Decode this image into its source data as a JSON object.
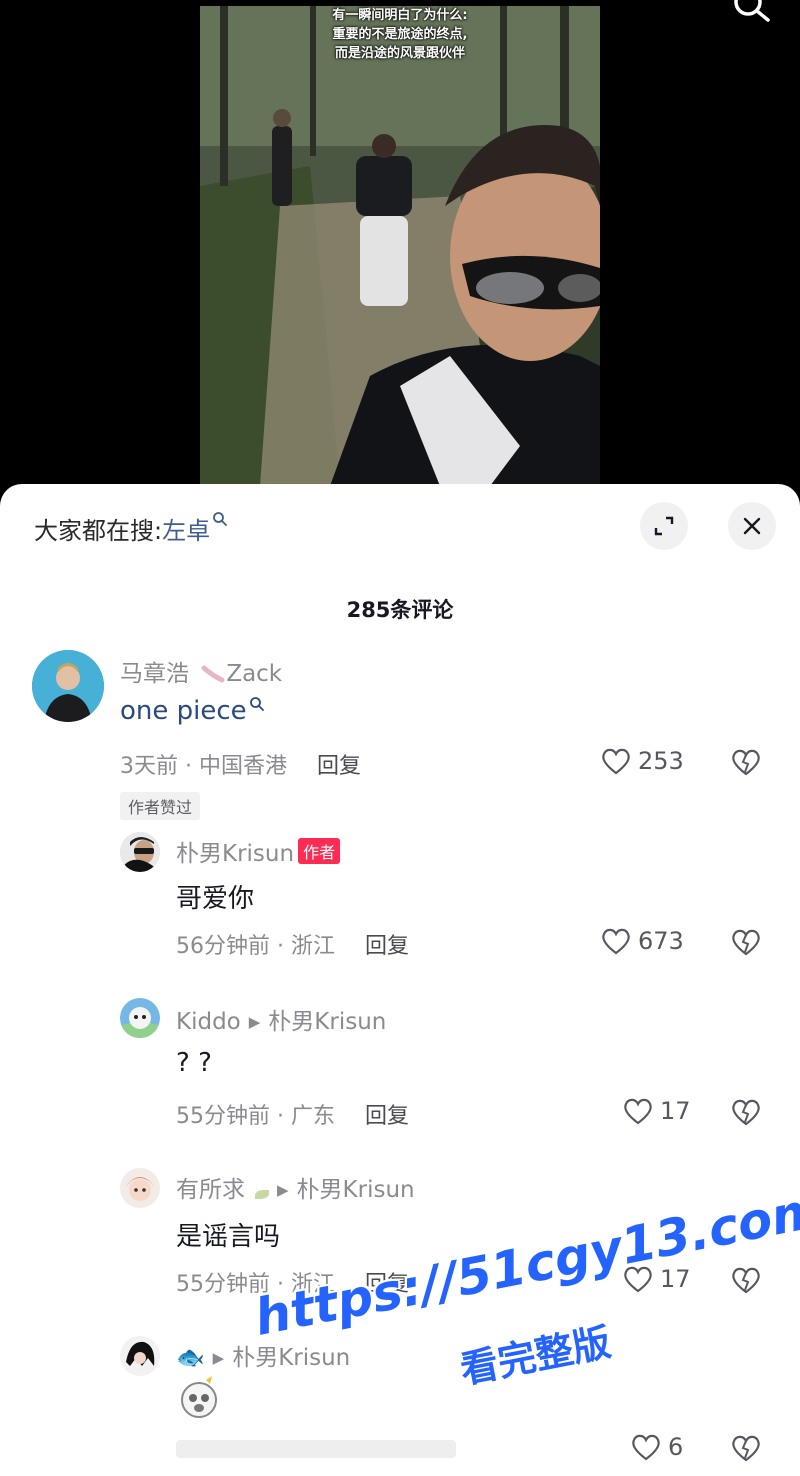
{
  "video": {
    "caption_lines": [
      "有一瞬间明白了为什么:",
      "重要的不是旅途的终点,",
      "而是沿途的风景跟伙伴"
    ]
  },
  "header": {
    "search_prefix": "大家都在搜:",
    "search_keyword": "左卓"
  },
  "comment_count": "285条评论",
  "comments": [
    {
      "author": "马章浩",
      "author_suffix": "Zack",
      "text": "one piece",
      "time": "3天前",
      "location": "中国香港",
      "reply_label": "回复",
      "likes": "253",
      "badge": "作者赞过"
    },
    {
      "author": "朴男Krisun",
      "tag": "作者",
      "text": "哥爱你",
      "time": "56分钟前",
      "location": "浙江",
      "reply_label": "回复",
      "likes": "673"
    },
    {
      "author": "Kiddo",
      "reply_to": "朴男Krisun",
      "text": "? ?",
      "time": "55分钟前",
      "location": "广东",
      "reply_label": "回复",
      "likes": "17"
    },
    {
      "author": "有所求",
      "reply_to": "朴男Krisun",
      "text": "是谣言吗",
      "time": "55分钟前",
      "location": "浙江",
      "reply_label": "回复",
      "likes": "17"
    },
    {
      "author": "🐟",
      "reply_to": "朴男Krisun",
      "likes": "6"
    }
  ],
  "watermark": {
    "url": "https://51cgy13.com",
    "subtitle": "看完整版"
  },
  "colors": {
    "accent_red": "#fe2c55",
    "keyword_blue": "#3f5e8c",
    "watermark_blue": "#2563ff"
  },
  "icons": [
    "search-icon",
    "expand-icon",
    "close-icon",
    "heart-icon",
    "broken-heart-icon"
  ]
}
